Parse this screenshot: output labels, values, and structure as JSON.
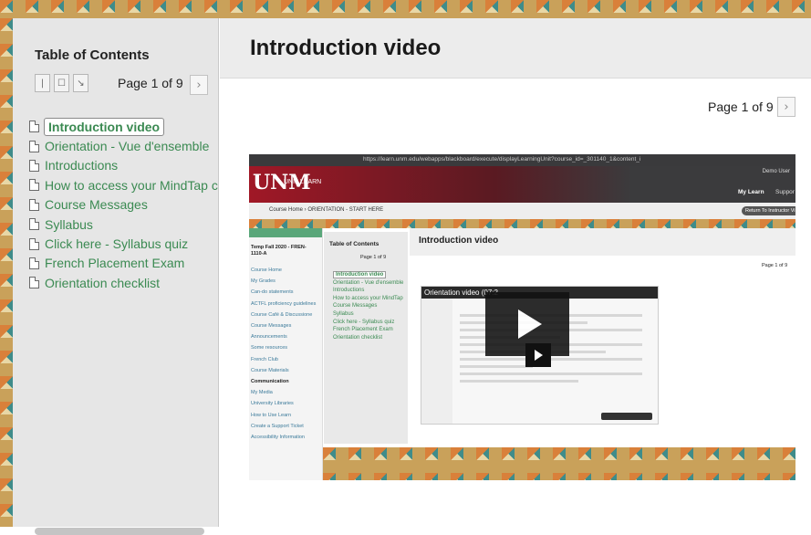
{
  "toc": {
    "title": "Table of Contents",
    "page_label": "Page 1 of 9",
    "items": [
      {
        "label": "Introduction video",
        "active": true
      },
      {
        "label": "Orientation - Vue d'ensemble"
      },
      {
        "label": "Introductions"
      },
      {
        "label": "How to access your MindTap c"
      },
      {
        "label": "Course Messages"
      },
      {
        "label": "Syllabus"
      },
      {
        "label": "Click here - Syllabus quiz"
      },
      {
        "label": "French Placement Exam"
      },
      {
        "label": "Orientation checklist"
      }
    ]
  },
  "main": {
    "title": "Introduction video",
    "page_label": "Page 1 of 9"
  },
  "embedded": {
    "url": "https://learn.unm.edu/webapps/blackboard/execute/displayLearningUnit?course_id=_301140_1&content_i",
    "brand": "UNM LEARN",
    "user": "Demo User",
    "nav_my_learn": "My Learn",
    "nav_support": "Suppor",
    "breadcrumb": "Course Home › ORIENTATION - START HERE",
    "return_btn": "Return To Instructor Vi",
    "course": "Temp Fall 2020 - FREN-1110-A",
    "side_nav": [
      "Course Home",
      "My Grades",
      "",
      "Can-do statements",
      "ACTFL proficiency guidelines",
      "Course Café & Discussione",
      "Course Messages",
      "Announcements",
      "Some resources",
      "French Club",
      "Course Materials",
      "",
      "Communication",
      "My Media",
      "University Libraries",
      "How to Use Learn",
      "Create a Support Ticket",
      "Accessibility Information"
    ],
    "toc_title": "Table of Contents",
    "toc_page": "Page 1 of 9",
    "toc_items": [
      "Introduction video",
      "Orientation - Vue d'ensemble",
      "Introductions",
      "How to access your MindTap",
      "Course Messages",
      "Syllabus",
      "Click here - Syllabus quiz",
      "French Placement Exam",
      "Orientation checklist"
    ],
    "main_title": "Introduction video",
    "main_page": "Page 1 of 9",
    "video_title": "Orientation video (07:2"
  }
}
